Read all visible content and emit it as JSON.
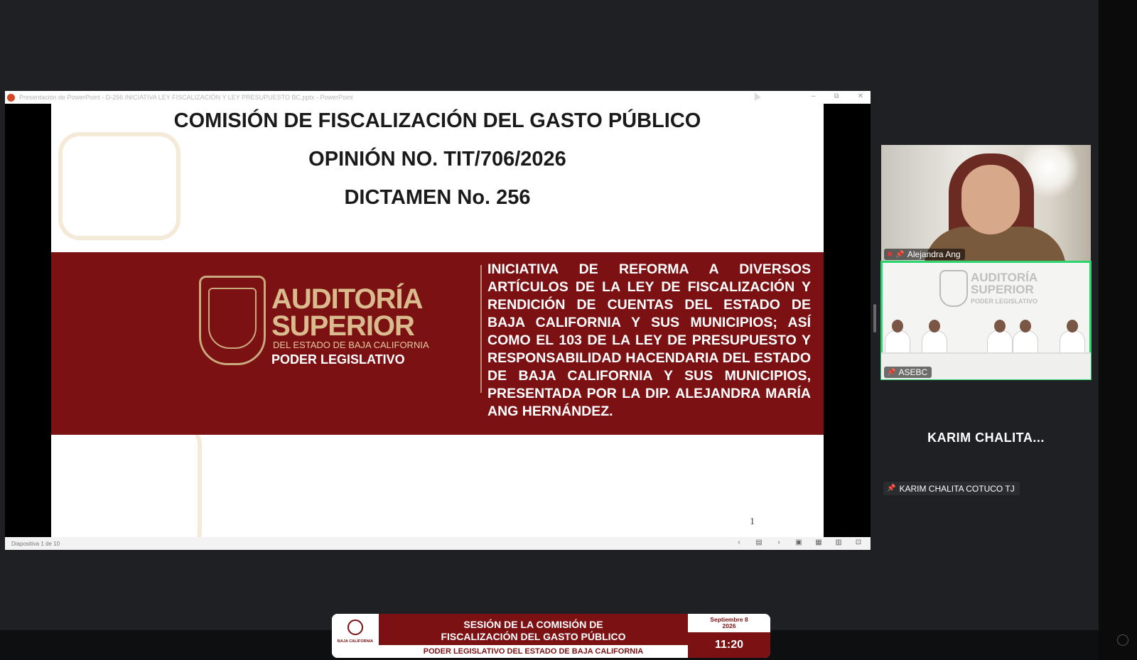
{
  "ppt_window": {
    "title": "Presentación de PowerPoint  -  D-256 INICIATIVA LEY FISCALIZACIÓN Y LEY PRESUPUESTO BC.pptx - PowerPoint",
    "window_controls": [
      "–",
      "⧉",
      "✕"
    ],
    "status_text": "Diapositiva 1 de 10",
    "nav_controls": [
      "‹",
      "▤",
      "›",
      "▣",
      "▦",
      "▥",
      "⊡"
    ]
  },
  "slide": {
    "title": "COMISIÓN DE FISCALIZACIÓN DEL GASTO PÚBLICO",
    "opinion": "OPINIÓN  NO. TIT/706/2026",
    "dictamen": "DICTAMEN No. 256",
    "logo": {
      "line1": "AUDITORÍA",
      "line2": "SUPERIOR",
      "line3": "DEL ESTADO DE BAJA CALIFORNIA",
      "line4": "PODER LEGISLATIVO"
    },
    "description": "INICIATIVA DE REFORMA A DIVERSOS ARTÍCULOS DE LA LEY DE FISCALIZACIÓN Y RENDICIÓN DE CUENTAS DEL ESTADO DE BAJA CALIFORNIA Y SUS MUNICIPIOS; ASÍ COMO EL 103 DE LA LEY DE PRESUPUESTO Y RESPONSABILIDAD HACENDARIA DEL ESTADO DE BAJA CALIFORNIA Y SUS MUNICIPIOS, PRESENTADA POR LA DIP. ALEJANDRA MARÍA ANG HERNÁNDEZ.",
    "page_number": "1"
  },
  "participants": [
    {
      "name": "Alejandra Ang",
      "muted": true,
      "pinned": true
    },
    {
      "name": "ASEBC",
      "pinned": true,
      "active_speaker": true,
      "wall_logo": {
        "line1": "AUDITORÍA",
        "line2": "SUPERIOR",
        "line3": "PODER LEGISLATIVO"
      }
    },
    {
      "display_name": "KARIM  CHALITA...",
      "name": "KARIM CHALITA COTUCO TJ",
      "pinned": true,
      "video_off": true
    }
  ],
  "lower_third": {
    "logo_text": "BAJA CALIFORNIA",
    "title_line1": "SESIÓN DE LA COMISIÓN DE",
    "title_line2": "FISCALIZACIÓN DEL GASTO PÚBLICO",
    "subtitle": "PODER LEGISLATIVO DEL ESTADO DE BAJA CALIFORNIA",
    "date_line1": "Septiembre 8",
    "date_line2": "2026",
    "time": "11:20"
  },
  "colors": {
    "brand_maroon": "#7c1114",
    "gold": "#d9bb8d",
    "active_speaker": "#2bd46c"
  }
}
